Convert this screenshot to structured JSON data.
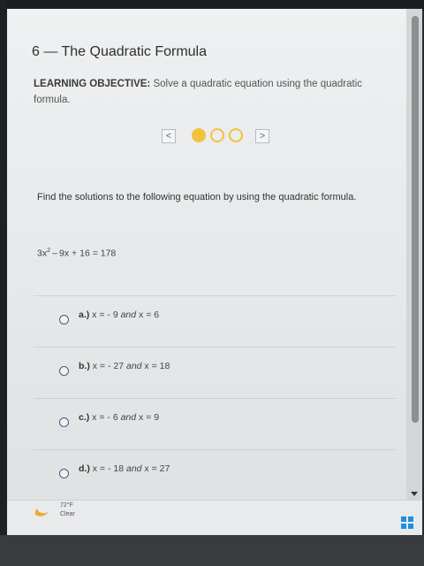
{
  "page": {
    "title": "6 — The Quadratic Formula",
    "objective_label": "LEARNING OBJECTIVE:",
    "objective_text": " Solve a quadratic equation using the quadratic formula."
  },
  "pager": {
    "prev_symbol": "<",
    "next_symbol": ">",
    "dots": [
      "active",
      "empty",
      "empty"
    ],
    "color": "#f4c13d"
  },
  "question": {
    "prompt": "Find the solutions to the following equation by using the quadratic formula.",
    "equation_base": "3x",
    "equation_exp": "2",
    "equation_rest": " – 9x + 16 = 178"
  },
  "options": [
    {
      "letter": "a.)",
      "pre": " x = - 9 ",
      "and": "and",
      "post": " x = 6"
    },
    {
      "letter": "b.)",
      "pre": " x = - 27 ",
      "and": "and",
      "post": " x = 18"
    },
    {
      "letter": "c.)",
      "pre": " x = - 6 ",
      "and": "and",
      "post": " x = 9"
    },
    {
      "letter": "d.)",
      "pre": " x = - 18 ",
      "and": "and",
      "post": " x = 27"
    }
  ],
  "taskbar": {
    "temperature": "72°F",
    "condition": "Clear",
    "start_icon": "windows-start-icon",
    "weather_icon": "moon-icon"
  }
}
